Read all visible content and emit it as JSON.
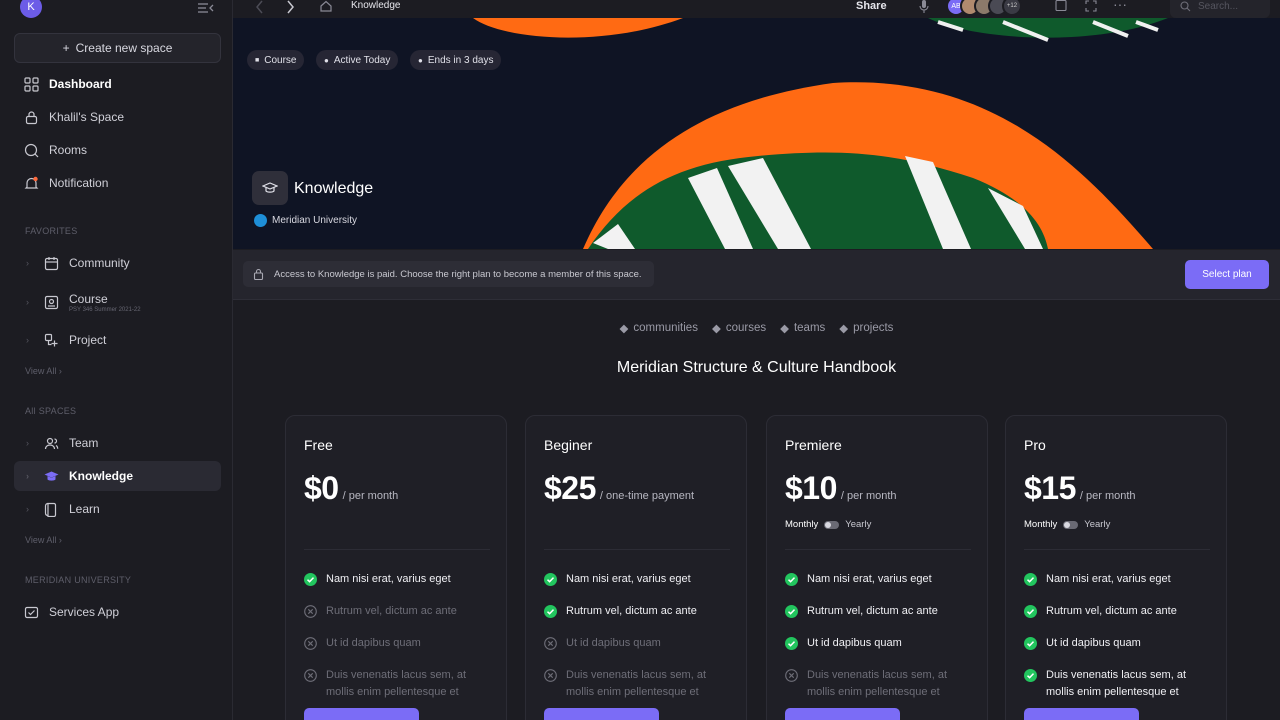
{
  "sidebar": {
    "avatar_letter": "K",
    "create_label": "Create new space",
    "nav": [
      {
        "label": "Dashboard",
        "icon": "grid-icon"
      },
      {
        "label": "Khalil's Space",
        "icon": "lock-icon"
      },
      {
        "label": "Rooms",
        "icon": "chat-icon"
      },
      {
        "label": "Notification",
        "icon": "bell-icon"
      }
    ],
    "favorites_label": "FAVORITES",
    "favorites": [
      {
        "label": "Community",
        "icon": "calendar-icon"
      },
      {
        "label": "Course",
        "sub": "PSY 346 Summer 2021-22",
        "icon": "book-icon"
      },
      {
        "label": "Project",
        "icon": "project-icon"
      }
    ],
    "view_all_label": "View All",
    "all_spaces_label": "All SPACES",
    "spaces": [
      {
        "label": "Team",
        "icon": "team-icon"
      },
      {
        "label": "Knowledge",
        "icon": "graduation-cap-icon"
      },
      {
        "label": "Learn",
        "icon": "learn-icon"
      }
    ],
    "org_label": "MERIDIAN UNIVERSITY",
    "org_items": [
      {
        "label": "Services App",
        "icon": "check-square-icon"
      }
    ]
  },
  "topbar": {
    "breadcrumb": "Knowledge",
    "share_label": "Share",
    "avatars_initials": "AB",
    "avatar_more": "+12",
    "search_placeholder": "Search..."
  },
  "hero": {
    "chips": [
      "Course",
      "Active Today",
      "Ends in 3 days"
    ],
    "title": "Knowledge",
    "org": "Meridian University"
  },
  "notice": {
    "text": "Access to Knowledge is paid. Choose the right plan to become a member of this space.",
    "button": "Select plan"
  },
  "tags": [
    "communities",
    "courses",
    "teams",
    "projects"
  ],
  "handbook_title": "Meridian Structure & Culture Handbook",
  "plans": [
    {
      "name": "Free",
      "price": "$0",
      "per": "/ per month",
      "toggle": false,
      "features": [
        {
          "text": "Nam nisi erat, varius eget",
          "on": true
        },
        {
          "text": "Rutrum vel, dictum ac ante",
          "on": false
        },
        {
          "text": "Ut id dapibus quam",
          "on": false
        },
        {
          "text": "Duis venenatis lacus sem, at mollis enim pellentesque et",
          "on": false
        }
      ]
    },
    {
      "name": "Beginer",
      "price": "$25",
      "per": "/ one-time payment",
      "toggle": false,
      "features": [
        {
          "text": "Nam nisi erat, varius eget",
          "on": true
        },
        {
          "text": "Rutrum vel, dictum ac ante",
          "on": true
        },
        {
          "text": "Ut id dapibus quam",
          "on": false
        },
        {
          "text": "Duis venenatis lacus sem, at mollis enim pellentesque et",
          "on": false
        }
      ]
    },
    {
      "name": "Premiere",
      "price": "$10",
      "per": "/ per month",
      "toggle": true,
      "features": [
        {
          "text": "Nam nisi erat, varius eget",
          "on": true
        },
        {
          "text": "Rutrum vel, dictum ac ante",
          "on": true
        },
        {
          "text": "Ut id dapibus quam",
          "on": true
        },
        {
          "text": "Duis venenatis lacus sem, at mollis enim pellentesque et",
          "on": false
        }
      ]
    },
    {
      "name": "Pro",
      "price": "$15",
      "per": "/ per month",
      "toggle": true,
      "features": [
        {
          "text": "Nam nisi erat, varius eget",
          "on": true
        },
        {
          "text": "Rutrum vel, dictum ac ante",
          "on": true
        },
        {
          "text": "Ut id dapibus quam",
          "on": true
        },
        {
          "text": "Duis venenatis lacus sem, at mollis enim pellentesque et",
          "on": true
        }
      ]
    }
  ],
  "toggle_labels": {
    "left": "Monthly",
    "right": "Yearly"
  },
  "colors": {
    "accent": "#7b6cf6",
    "check": "#22c55e",
    "hero_orange": "#ff6a13",
    "hero_green": "#0f5a2c"
  }
}
